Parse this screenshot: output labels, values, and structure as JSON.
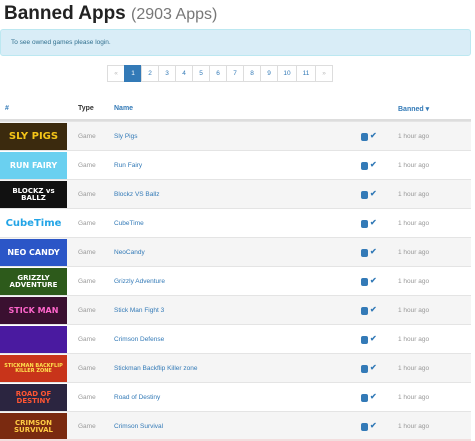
{
  "header": {
    "title": "Banned Apps",
    "count": "(2903 Apps)"
  },
  "alert": {
    "text": "To see owned games please login."
  },
  "pagination": {
    "pages": [
      "«",
      "1",
      "2",
      "3",
      "4",
      "5",
      "6",
      "7",
      "8",
      "9",
      "10",
      "11",
      "»"
    ],
    "current": "1"
  },
  "table": {
    "headers": {
      "index": "#",
      "type": "Type",
      "name": "Name",
      "banned": "Banned ▾"
    },
    "rows": [
      {
        "thumb": "SLY PIGS",
        "type": "Game",
        "name": "Sly Pigs",
        "banned": "1 hour ago",
        "bg": "#3b2a0e",
        "fg": "#f5c518"
      },
      {
        "thumb": "RUN FAIRY",
        "type": "Game",
        "name": "Run Fairy",
        "banned": "1 hour ago",
        "bg": "#6ad0f0",
        "fg": "#ffffff"
      },
      {
        "thumb": "BLOCKZ vs BALLZ",
        "type": "Game",
        "name": "Blockz VS Ballz",
        "banned": "1 hour ago",
        "bg": "#111111",
        "fg": "#ffffff"
      },
      {
        "thumb": "CubeTime",
        "type": "Game",
        "name": "CubeTime",
        "banned": "1 hour ago",
        "bg": "#ffffff",
        "fg": "#22a4e6"
      },
      {
        "thumb": "NEO CANDY",
        "type": "Game",
        "name": "NeoCandy",
        "banned": "1 hour ago",
        "bg": "#2b56c7",
        "fg": "#ffffff"
      },
      {
        "thumb": "GRIZZLY ADVENTURE",
        "type": "Game",
        "name": "Grizzly Adventure",
        "banned": "1 hour ago",
        "bg": "#2d5a1b",
        "fg": "#ffffff"
      },
      {
        "thumb": "STICK MAN",
        "type": "Game",
        "name": "Stick Man Fight 3",
        "banned": "1 hour ago",
        "bg": "#3a1030",
        "fg": "#ff66cc"
      },
      {
        "thumb": "",
        "type": "Game",
        "name": "Crimson Defense",
        "banned": "1 hour ago",
        "bg": "#4a1aa0",
        "fg": "#ffffff"
      },
      {
        "thumb": "STICKMAN BACKFLIP KILLER ZONE",
        "type": "Game",
        "name": "Stickman Backflip Killer zone",
        "banned": "1 hour ago",
        "bg": "#c8341a",
        "fg": "#ffe14d"
      },
      {
        "thumb": "ROAD OF DESTINY",
        "type": "Game",
        "name": "Road of Destiny",
        "banned": "1 hour ago",
        "bg": "#2b2540",
        "fg": "#ff5533"
      },
      {
        "thumb": "CRIMSON SURVIVAL",
        "type": "Game",
        "name": "Crimson Survival",
        "banned": "1 hour ago",
        "bg": "#7a2a10",
        "fg": "#ffcc44"
      }
    ]
  }
}
